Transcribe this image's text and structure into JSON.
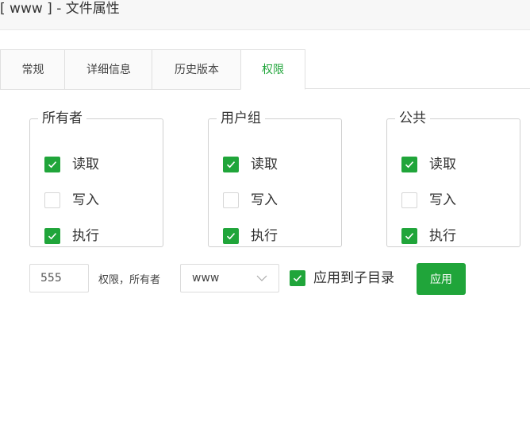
{
  "window": {
    "title": "[ www ] - 文件属性"
  },
  "tabs": [
    {
      "label": "常规"
    },
    {
      "label": "详细信息"
    },
    {
      "label": "历史版本"
    },
    {
      "label": "权限"
    }
  ],
  "active_tab": "权限",
  "groups": [
    {
      "title": "所有者",
      "perms": [
        {
          "label": "读取",
          "checked": true
        },
        {
          "label": "写入",
          "checked": false
        },
        {
          "label": "执行",
          "checked": true
        }
      ]
    },
    {
      "title": "用户组",
      "perms": [
        {
          "label": "读取",
          "checked": true
        },
        {
          "label": "写入",
          "checked": false
        },
        {
          "label": "执行",
          "checked": true
        }
      ]
    },
    {
      "title": "公共",
      "perms": [
        {
          "label": "读取",
          "checked": true
        },
        {
          "label": "写入",
          "checked": false
        },
        {
          "label": "执行",
          "checked": true
        }
      ]
    }
  ],
  "footer": {
    "permission_value": "555",
    "permission_owner_label": "权限，所有者",
    "owner_selected": "www",
    "apply_subdirs_label": "应用到子目录",
    "apply_subdirs_checked": true,
    "apply_button": "应用"
  },
  "colors": {
    "accent": "#20a53a"
  }
}
